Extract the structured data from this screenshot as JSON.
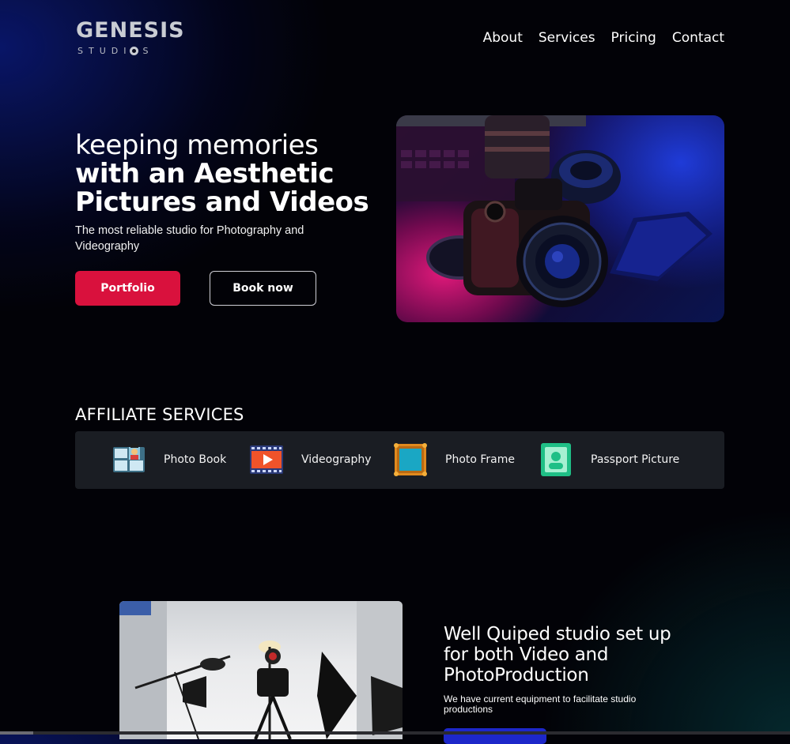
{
  "header": {
    "logo_main": "GENESIS",
    "logo_sub_left": "STUDI",
    "logo_sub_right": "S",
    "nav": [
      "About",
      "Services",
      "Pricing",
      "Contact"
    ]
  },
  "hero": {
    "title_line1": "keeping memories",
    "title_prefix": "with an ",
    "title_bold": "Aesthetic Pictures and Videos",
    "subtitle": "The most reliable studio for Photography and Videography",
    "btn_primary": "Portfolio",
    "btn_secondary": "Book now"
  },
  "affiliate": {
    "title": "AFFILIATE SERVICES",
    "items": [
      {
        "label": "Photo Book",
        "icon": "photo-book-icon"
      },
      {
        "label": "Videography",
        "icon": "videography-icon"
      },
      {
        "label": "Photo Frame",
        "icon": "photo-frame-icon"
      },
      {
        "label": "Passport Picture",
        "icon": "passport-picture-icon"
      }
    ]
  },
  "studio": {
    "title": "Well Quiped studio set up for both Video and PhotoProduction",
    "subtitle": "We have current equipment to facilitate studio productions"
  },
  "colors": {
    "primary": "#d9113d",
    "studio_button": "#1d27c9",
    "affiliate_bar": "#1a1d23"
  }
}
